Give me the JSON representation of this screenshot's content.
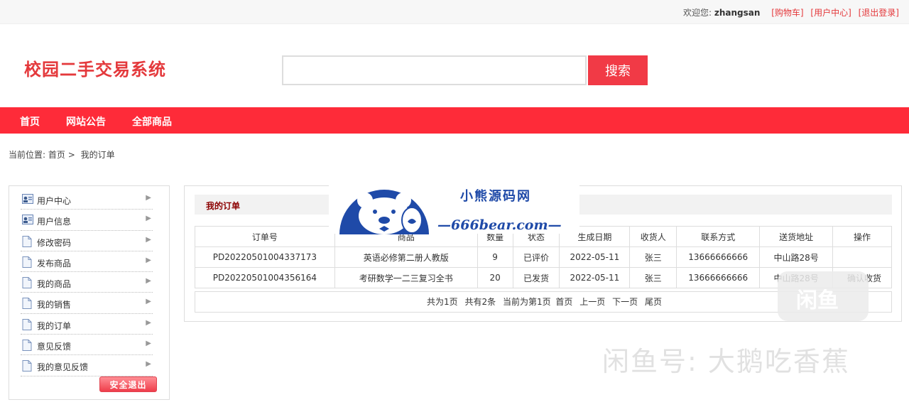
{
  "topbar": {
    "welcome": "欢迎您:",
    "username": "zhangsan",
    "cart_link": "[购物车]",
    "user_center_link": "[用户中心]",
    "logout_link": "[退出登录]"
  },
  "header": {
    "site_title": "校园二手交易系统",
    "search_placeholder": "",
    "search_button": "搜索"
  },
  "nav": {
    "items": [
      "首页",
      "网站公告",
      "全部商品"
    ]
  },
  "breadcrumb": {
    "label": "当前位置:",
    "home": "首页",
    "sep": ">",
    "current": "我的订单"
  },
  "sidebar": {
    "items": [
      {
        "label": "用户中心",
        "icon": "user-card-icon"
      },
      {
        "label": "用户信息",
        "icon": "user-card-icon"
      },
      {
        "label": "修改密码",
        "icon": "document-icon"
      },
      {
        "label": "发布商品",
        "icon": "document-icon"
      },
      {
        "label": "我的商品",
        "icon": "document-icon"
      },
      {
        "label": "我的销售",
        "icon": "document-icon"
      },
      {
        "label": "我的订单",
        "icon": "document-icon"
      },
      {
        "label": "意见反馈",
        "icon": "document-icon"
      },
      {
        "label": "我的意见反馈",
        "icon": "document-icon"
      }
    ],
    "logout_button": "安全退出"
  },
  "main": {
    "panel_title": "我的订单",
    "columns": [
      "订单号",
      "商品",
      "数量",
      "状态",
      "生成日期",
      "收货人",
      "联系方式",
      "送货地址",
      "操作"
    ],
    "rows": [
      [
        "PD20220501004337173",
        "英语必修第二册人教版",
        "9",
        "已评价",
        "2022-05-11",
        "张三",
        "13666666666",
        "中山路28号",
        ""
      ],
      [
        "PD20220501004356164",
        "考研数学一二三复习全书",
        "20",
        "已发货",
        "2022-05-11",
        "张三",
        "13666666666",
        "中山路28号",
        "确认收货"
      ]
    ],
    "pager": {
      "total_pages": "共为1页",
      "total_items": "共有2条",
      "current": "当前为第1页",
      "first": "首页",
      "prev": "上一页",
      "next": "下一页",
      "last": "尾页"
    }
  },
  "watermark": {
    "brand": "小熊源码网",
    "url": "—666bear.com—",
    "xianyu_logo": "闲鱼",
    "xianyu_text": "闲鱼号: 大鹅吃香蕉"
  },
  "colors": {
    "accent": "#fe2b39",
    "title_red": "#e4393c",
    "panel_title": "#8b0000",
    "watermark_blue": "#1f4aa8"
  }
}
